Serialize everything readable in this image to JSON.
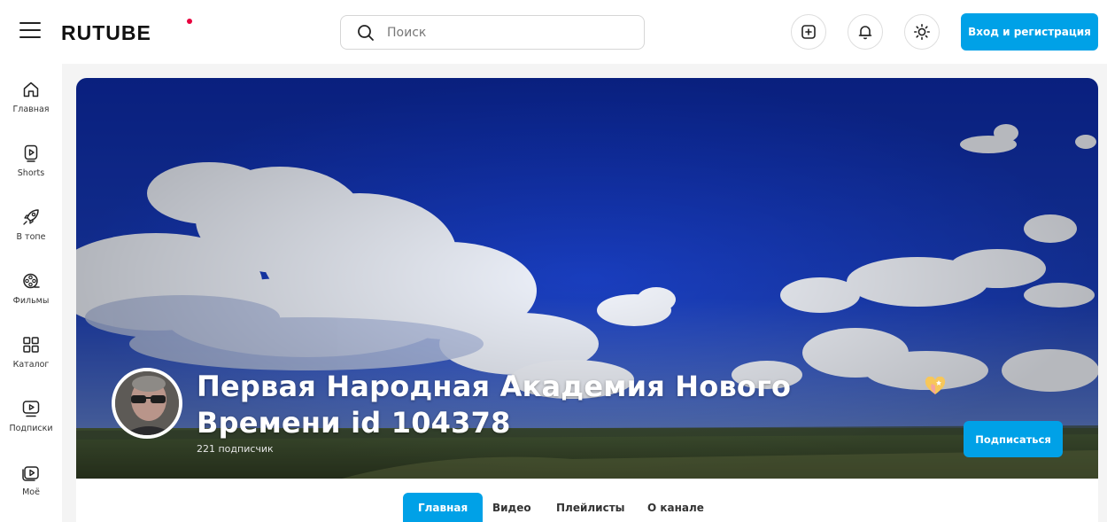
{
  "header": {
    "logo": "RUTUBE",
    "search_placeholder": "Поиск",
    "login_label": "Вход и регистрация"
  },
  "sidebar": {
    "items": [
      {
        "label": "Главная",
        "icon": "home-icon"
      },
      {
        "label": "Shorts",
        "icon": "shorts-icon"
      },
      {
        "label": "В топе",
        "icon": "rocket-icon"
      },
      {
        "label": "Фильмы",
        "icon": "film-reel-icon"
      },
      {
        "label": "Каталог",
        "icon": "grid-icon"
      },
      {
        "label": "Подписки",
        "icon": "subscriptions-icon"
      },
      {
        "label": "Моё",
        "icon": "my-videos-icon"
      }
    ]
  },
  "channel": {
    "title": "Первая Народная Академия Нового Времени id 104378",
    "subscribers": "221 подписчик",
    "subscribe_label": "Подписаться"
  },
  "tabs": [
    {
      "label": "Главная",
      "active": true
    },
    {
      "label": "Видео",
      "active": false
    },
    {
      "label": "Плейлисты",
      "active": false
    },
    {
      "label": "О канале",
      "active": false
    }
  ],
  "colors": {
    "accent": "#00a1e7",
    "logo_dot": "#e8003d",
    "sky": "#1a3fbf"
  }
}
